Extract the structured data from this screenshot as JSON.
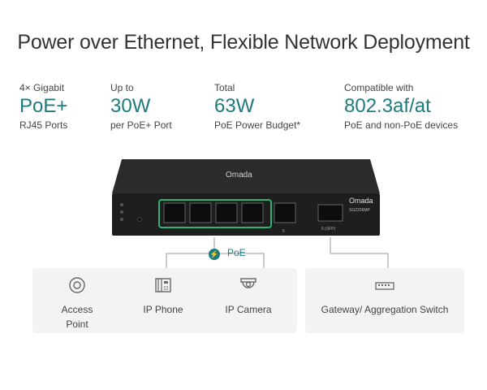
{
  "title": "Power over Ethernet, Flexible Network Deployment",
  "specs": [
    {
      "small": "4× Gigabit",
      "big": "PoE+",
      "sub": "RJ45 Ports"
    },
    {
      "small": "Up to",
      "big": "30W",
      "sub": "per PoE+ Port"
    },
    {
      "small": "Total",
      "big": "63W",
      "sub": "PoE Power Budget*"
    },
    {
      "small": "Compatible with",
      "big": "802.3af/at",
      "sub": "PoE and non-PoE devices"
    }
  ],
  "device": {
    "brand": "Omada",
    "model": "SG2206MP",
    "port_label": "5",
    "sfp_label": "6 (SFP)"
  },
  "poe_label": "PoE",
  "devices_left": [
    {
      "label_line1": "Access",
      "label_line2": "Point",
      "icon": "access-point-icon"
    },
    {
      "label_line1": "IP Phone",
      "label_line2": "",
      "icon": "ip-phone-icon"
    },
    {
      "label_line1": "IP Camera",
      "label_line2": "",
      "icon": "ip-camera-icon"
    }
  ],
  "devices_right": [
    {
      "label_line1": "Gateway/ Aggregation Switch",
      "icon": "switch-icon"
    }
  ],
  "colors": {
    "accent": "#1d7a80",
    "poe_highlight": "#2bb37a",
    "card": "#f3f3f3"
  }
}
